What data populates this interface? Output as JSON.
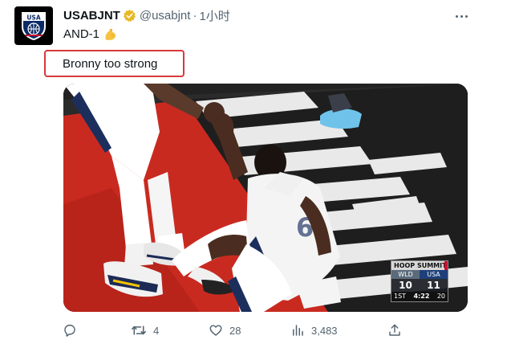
{
  "tweet": {
    "author": {
      "display_name": "USABJNT",
      "handle": "@usabjnt",
      "avatar_text": "USA",
      "verified_color": "#e8b829"
    },
    "separator": "·",
    "time": "1小时",
    "text": "AND-1",
    "text_emoji": "flexed-biceps",
    "quoted_caption": "Bronny too strong",
    "highlight_color": "#d9393b",
    "media": {
      "scoreboard": {
        "title": "HOOP SUMMIT",
        "team_left": "WLD",
        "team_right": "USA",
        "score_left": "10",
        "score_right": "11",
        "period": "1ST",
        "game_clock": "4:22",
        "shot_clock": "20"
      }
    },
    "actions": {
      "reply_count": "",
      "retweet_count": "4",
      "like_count": "28",
      "views_count": "3,483"
    },
    "colors": {
      "text_primary": "#0f1419",
      "text_secondary": "#536471",
      "court_red": "#c92a20",
      "court_dark": "#1a1a1a"
    }
  }
}
